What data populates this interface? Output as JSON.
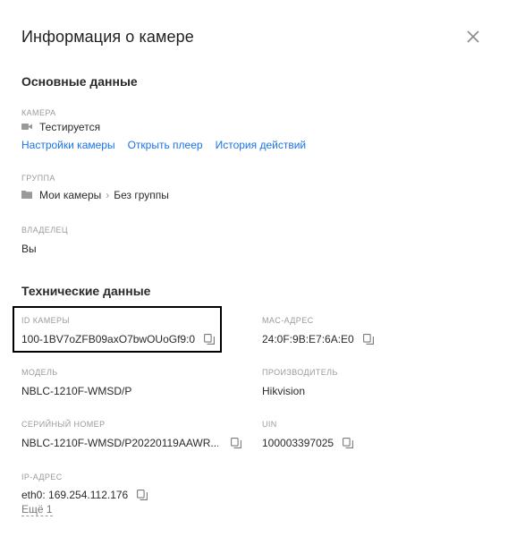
{
  "dialog": {
    "title": "Информация о камере"
  },
  "basic": {
    "section_title": "Основные данные",
    "camera": {
      "label": "КАМЕРА",
      "value": "Тестируется",
      "icon": "camera-icon",
      "links": [
        "Настройки камеры",
        "Открыть плеер",
        "История действий"
      ]
    },
    "group": {
      "label": "ГРУППА",
      "icon": "folder-icon",
      "path": [
        "Мои камеры",
        "Без группы"
      ],
      "separator": "›"
    },
    "owner": {
      "label": "ВЛАДЕЛЕЦ",
      "value": "Вы"
    }
  },
  "technical": {
    "section_title": "Технические данные",
    "camera_id": {
      "label": "ID КАМЕРЫ",
      "value": "100-1BV7oZFB09axO7bwOUoGf9:0"
    },
    "mac": {
      "label": "MAC-АДРЕС",
      "value": "24:0F:9B:E7:6A:E0"
    },
    "model": {
      "label": "МОДЕЛЬ",
      "value": "NBLC-1210F-WMSD/P"
    },
    "manufacturer": {
      "label": "ПРОИЗВОДИТЕЛЬ",
      "value": "Hikvision"
    },
    "serial": {
      "label": "СЕРИЙНЫЙ НОМЕР",
      "value": "NBLC-1210F-WMSD/P20220119AAWR..."
    },
    "uin": {
      "label": "UIN",
      "value": "100003397025"
    },
    "ip": {
      "label": "IP-АДРЕС",
      "value": "eth0: 169.254.112.176",
      "more": "Ещё 1"
    }
  },
  "colors": {
    "link": "#1a73e8",
    "label": "#9a9a9a",
    "text": "#2a2a2a",
    "highlight_border": "#000000"
  }
}
